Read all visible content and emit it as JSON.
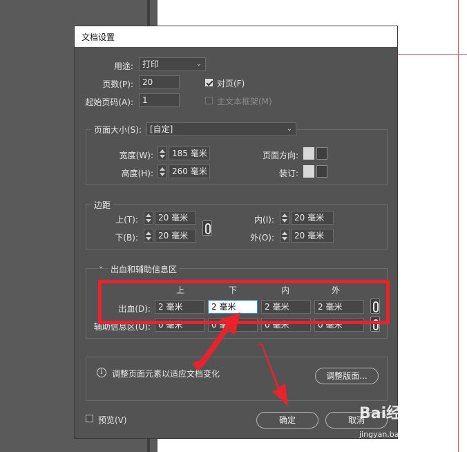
{
  "dialog": {
    "title": "文档设置",
    "intent_label": "用途:",
    "intent_value": "打印",
    "pages_label": "页数(P):",
    "pages_value": "20",
    "start_label": "起始页码(A):",
    "start_value": "1",
    "facing_label": "对页(F)",
    "facing_checked": true,
    "master_label": "主文本框架(M)",
    "master_checked": false
  },
  "page_size": {
    "label": "页面大小(S):",
    "value": "[自定]",
    "width_label": "宽度(W):",
    "width_value": "185 毫米",
    "height_label": "高度(H):",
    "height_value": "260 毫米",
    "orientation_label": "页面方向:",
    "binding_label": "装订:"
  },
  "margins": {
    "title": "边距",
    "top_label": "上(T):",
    "top_value": "20 毫米",
    "bottom_label": "下(B):",
    "bottom_value": "20 毫米",
    "inside_label": "内(I):",
    "inside_value": "20 毫米",
    "outside_label": "外(O):",
    "outside_value": "20 毫米"
  },
  "bleed": {
    "title": "出血和辅助信息区",
    "col_top": "上",
    "col_bottom": "下",
    "col_inside": "内",
    "col_outside": "外",
    "bleed_label": "出血(D):",
    "bleed_top": "2 毫米",
    "bleed_bottom": "2 毫米",
    "bleed_inside": "2 毫米",
    "bleed_outside": "2 毫米",
    "slug_label": "辅助信息区(U):",
    "slug_top": "0 毫米",
    "slug_bottom": "0 毫米",
    "slug_inside": "0 毫米",
    "slug_outside": "0 毫米"
  },
  "adjust": {
    "info_text": "调整页面元素以适应文档变化",
    "button": "调整版面..."
  },
  "footer": {
    "preview_label": "预览(V)",
    "ok": "确定",
    "cancel": "取消"
  },
  "watermark": {
    "brand": "Bai经验",
    "url": "jingyan.baidu.com"
  },
  "colors": {
    "annotation_red": "#e8232e",
    "focus_blue": "#2d8ceb"
  }
}
